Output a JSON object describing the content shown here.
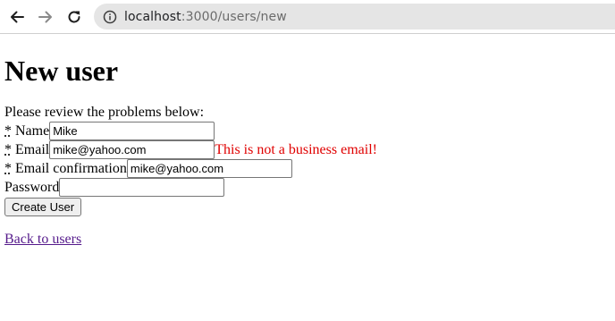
{
  "browser": {
    "url_host": "localhost",
    "url_rest": ":3000/users/new",
    "icons": {
      "back": "arrow-left-icon",
      "forward": "arrow-right-icon",
      "reload": "reload-icon",
      "site_info": "info-icon"
    }
  },
  "page": {
    "title": "New user",
    "error_header": "Please review the problems below:",
    "required_marker": "*",
    "fields": {
      "name": {
        "label": "Name",
        "value": "Mike"
      },
      "email": {
        "label": "Email",
        "value": "mike@yahoo.com",
        "error": "This is not a business email!"
      },
      "email_confirmation": {
        "label": "Email confirmation",
        "value": "mike@yahoo.com"
      },
      "password": {
        "label": "Password",
        "value": ""
      }
    },
    "submit_label": "Create User",
    "back_link": "Back to users"
  },
  "colors": {
    "error": "#e00000",
    "link_visited": "#551a8b",
    "address_bar": "#e5e5e5"
  }
}
